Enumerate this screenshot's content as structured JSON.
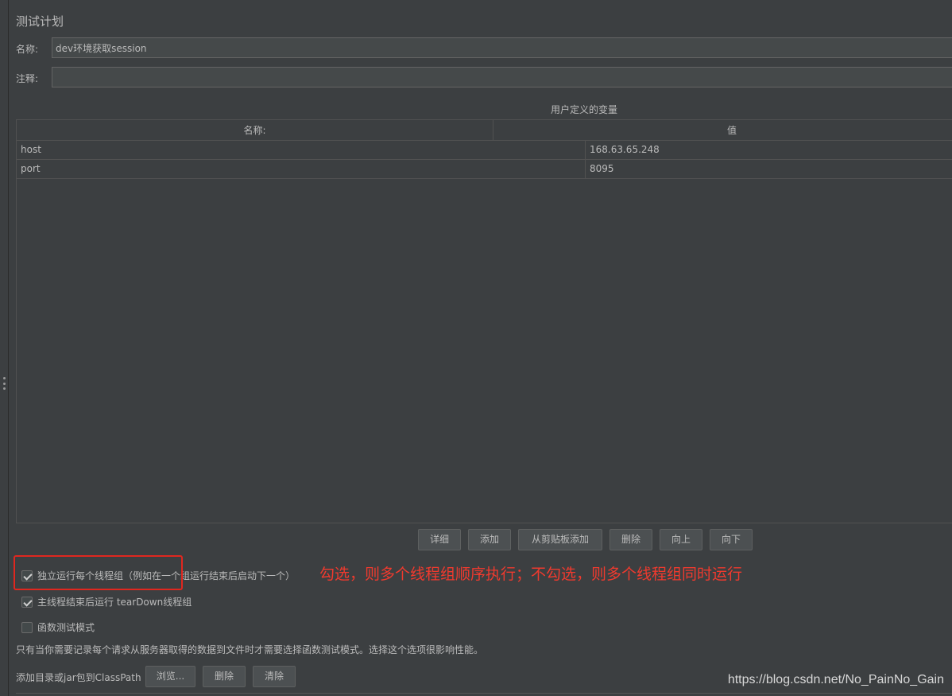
{
  "panel": {
    "title": "测试计划"
  },
  "form": {
    "name_label": "名称:",
    "name_value": "dev环境获取session",
    "comment_label": "注释:",
    "comment_value": ""
  },
  "variables_table": {
    "caption": "用户定义的变量",
    "headers": [
      "名称:",
      "值"
    ],
    "rows": [
      {
        "name": "host",
        "value": "168.63.65.248"
      },
      {
        "name": "port",
        "value": "8095"
      }
    ]
  },
  "table_buttons": {
    "detail": "详细",
    "add": "添加",
    "add_from_clipboard": "从剪贴板添加",
    "delete": "删除",
    "up": "向上",
    "down": "向下"
  },
  "options": {
    "run_serially": {
      "label": "独立运行每个线程组（例如在一个组运行结束后启动下一个）",
      "checked": true
    },
    "teardown_after_main": {
      "label": "主线程结束后运行 tearDown线程组",
      "checked": true
    },
    "functional_mode": {
      "label": "函数测试模式",
      "checked": false
    }
  },
  "annotation": "勾选，则多个线程组顺序执行；不勾选，则多个线程组同时运行",
  "help_text": "只有当你需要记录每个请求从服务器取得的数据到文件时才需要选择函数测试模式。选择这个选项很影响性能。",
  "classpath": {
    "label": "添加目录或jar包到ClassPath",
    "browse": "浏览...",
    "delete": "删除",
    "clear": "清除"
  },
  "watermark": "https://blog.csdn.net/No_PainNo_Gain",
  "colors": {
    "background": "#3c3f41",
    "annotation": "#f03a2e",
    "highlight_border": "#e0271f"
  }
}
